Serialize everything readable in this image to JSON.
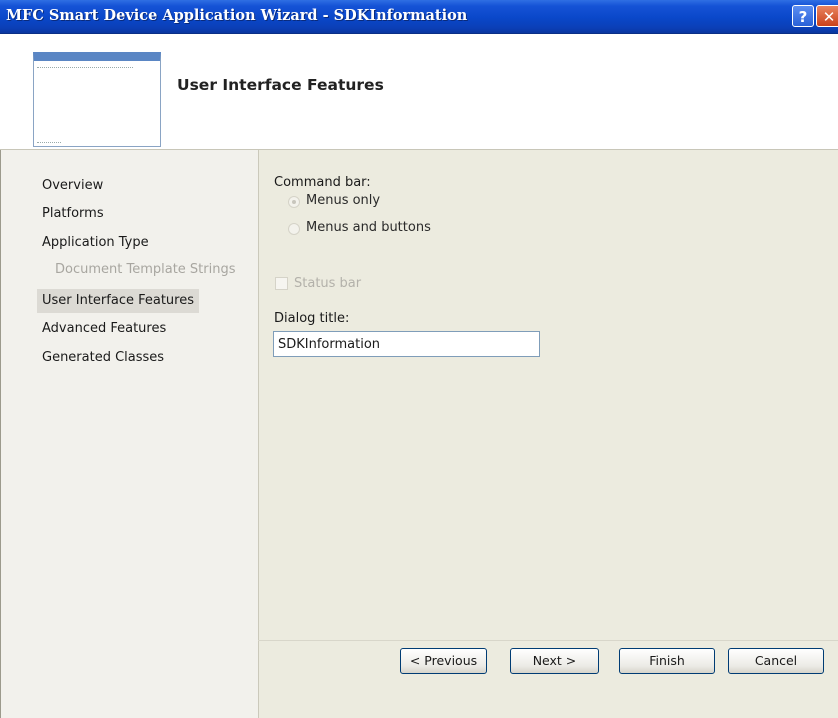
{
  "window": {
    "title": "MFC Smart Device Application Wizard - SDKInformation",
    "help_glyph": "?",
    "close_glyph": "✕"
  },
  "header": {
    "page_title": "User Interface Features"
  },
  "nav": {
    "items": [
      {
        "label": "Overview",
        "state": "normal"
      },
      {
        "label": "Platforms",
        "state": "normal"
      },
      {
        "label": "Application Type",
        "state": "normal"
      },
      {
        "label": "Document Template Strings",
        "state": "disabled"
      },
      {
        "label": "User Interface Features",
        "state": "selected"
      },
      {
        "label": "Advanced Features",
        "state": "normal"
      },
      {
        "label": "Generated Classes",
        "state": "normal"
      }
    ]
  },
  "main": {
    "command_bar_label": "Command bar:",
    "options": [
      {
        "label": "Menus only",
        "checked": true,
        "disabled": true
      },
      {
        "label": "Menus and buttons",
        "checked": false,
        "disabled": true
      }
    ],
    "status_bar_label": "Status bar",
    "status_bar_checked": false,
    "dialog_title_label": "Dialog title:",
    "dialog_title_value": "SDKInformation"
  },
  "footer": {
    "previous_label": "< Previous",
    "next_label": "Next >",
    "finish_label": "Finish",
    "cancel_label": "Cancel"
  },
  "colors": {
    "titlebar": "#0a47c9",
    "nav_background": "#f2f1ec",
    "main_background": "#ecebdf",
    "selected_item": "#dcdad4"
  }
}
